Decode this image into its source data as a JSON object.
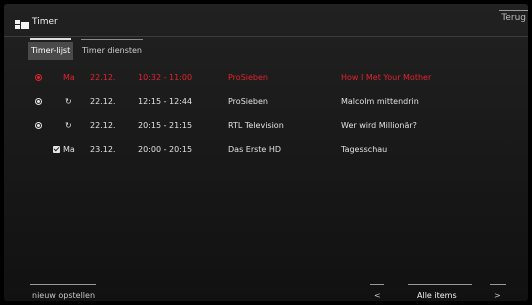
{
  "header": {
    "title": "Timer",
    "app_icon": "timer-app-icon",
    "back_label": "Terug"
  },
  "tabs": [
    {
      "label": "Timer-lijst",
      "active": true
    },
    {
      "label": "Timer diensten",
      "active": false
    }
  ],
  "timers": [
    {
      "status_icon": "record-icon",
      "day": "Ma",
      "date": "22.12.",
      "time": "10:32 - 11:00",
      "channel": "ProSieben",
      "title": "How I Met Your Mother",
      "highlight": true
    },
    {
      "status_icon": "record-icon",
      "mode_icon": "repeat-icon",
      "date": "22.12.",
      "time": "12:15 - 12:44",
      "channel": "ProSieben",
      "title": "Malcolm mittendrin"
    },
    {
      "status_icon": "record-icon",
      "mode_icon": "repeat-icon",
      "date": "22.12.",
      "time": "20:15 - 21:15",
      "channel": "RTL Television",
      "title": "Wer wird Millionär?"
    },
    {
      "mode_icon": "checkbox-icon",
      "day": "Ma",
      "date": "23.12.",
      "time": "20:00 - 20:15",
      "channel": "Das Erste HD",
      "title": "Tagesschau"
    }
  ],
  "footer": {
    "new_label": "nieuw opstellen",
    "prev_label": "<",
    "filter_label": "Alle items",
    "next_label": ">"
  },
  "colors": {
    "highlight": "#e0242d",
    "background": "#1b1b1b"
  }
}
